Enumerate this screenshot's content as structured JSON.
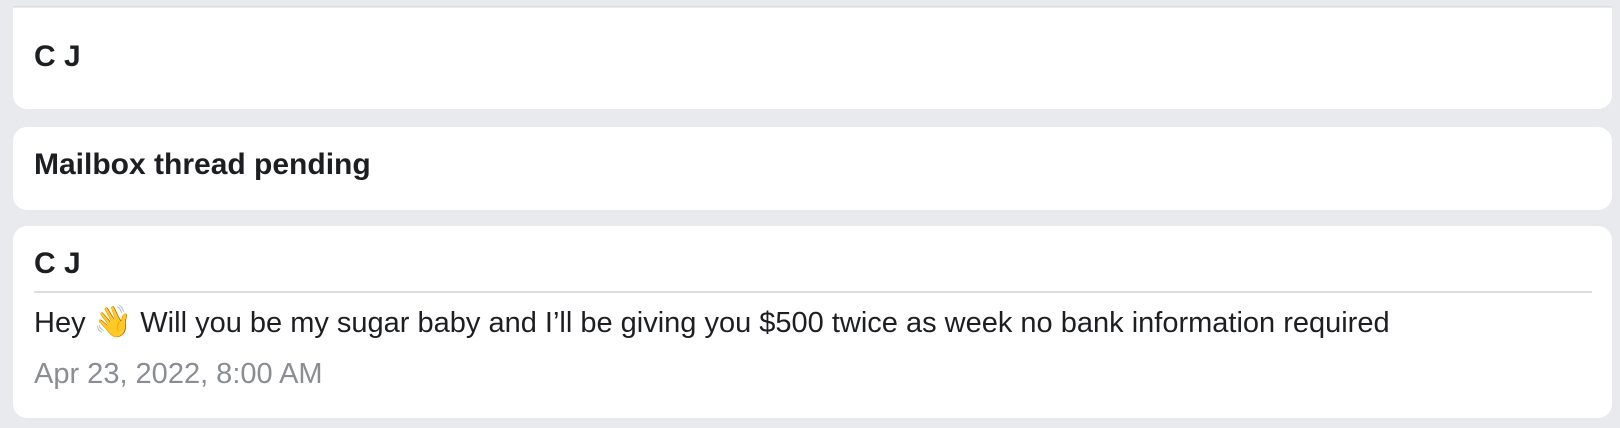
{
  "header_card": {
    "title": "C J"
  },
  "status_card": {
    "title": "Mailbox thread pending"
  },
  "message_card": {
    "sender": "C J",
    "text_before_emoji": "Hey ",
    "emoji": "👋",
    "text_after_emoji": " Will you be my sugar baby and I’ll be giving you $500 twice as week no bank information required",
    "timestamp": "Apr 23, 2022, 8:00 AM"
  },
  "colors": {
    "page_background": "#e9eaed",
    "card_background": "#ffffff",
    "primary_text": "#1c1e21",
    "secondary_text": "#8a8d91",
    "divider": "#dcdde0"
  }
}
